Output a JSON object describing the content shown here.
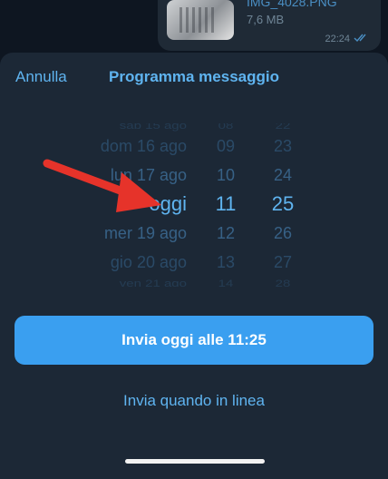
{
  "chat": {
    "file_name": "IMG_4028.PNG",
    "file_size": "7,6 MB",
    "time": "22:24"
  },
  "sheet": {
    "cancel_label": "Annulla",
    "title": "Programma messaggio"
  },
  "picker": {
    "rows": [
      {
        "day": "sab 15 ago",
        "hour": "08",
        "minute": "22"
      },
      {
        "day": "dom 16 ago",
        "hour": "09",
        "minute": "23"
      },
      {
        "day": "lun 17 ago",
        "hour": "10",
        "minute": "24"
      },
      {
        "day": "oggi",
        "hour": "11",
        "minute": "25"
      },
      {
        "day": "mer 19 ago",
        "hour": "12",
        "minute": "26"
      },
      {
        "day": "gio 20 ago",
        "hour": "13",
        "minute": "27"
      },
      {
        "day": "ven 21 ago",
        "hour": "14",
        "minute": "28"
      }
    ],
    "selected_index": 3
  },
  "buttons": {
    "send_label": "Invia oggi alle 11:25",
    "online_label": "Invia quando in linea"
  },
  "colors": {
    "accent": "#5fb4f0",
    "button": "#3a9ff0",
    "arrow": "#e6332a"
  }
}
